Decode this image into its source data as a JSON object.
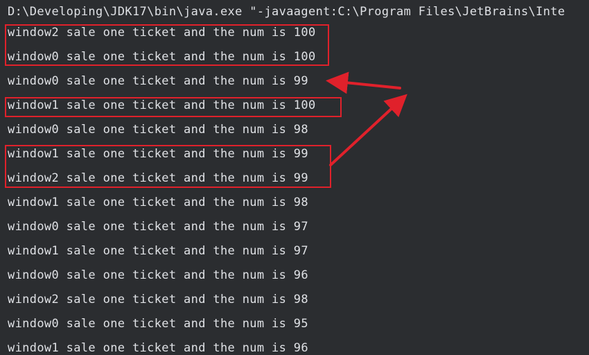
{
  "console": {
    "command": "D:\\Developing\\JDK17\\bin\\java.exe \"-javaagent:C:\\Program Files\\JetBrains\\Inte",
    "lines": [
      "window2 sale one ticket and the num is 100",
      "window0 sale one ticket and the num is 100",
      "window0 sale one ticket and the num is 99",
      "window1 sale one ticket and the num is 100",
      "window0 sale one ticket and the num is 98",
      "window1 sale one ticket and the num is 99",
      "window2 sale one ticket and the num is 99",
      "window1 sale one ticket and the num is 98",
      "window0 sale one ticket and the num is 97",
      "window1 sale one ticket and the num is 97",
      "window0 sale one ticket and the num is 96",
      "window2 sale one ticket and the num is 98",
      "window0 sale one ticket and the num is 95",
      "window1 sale one ticket and the num is 96"
    ]
  },
  "colors": {
    "background": "#2b2d30",
    "text": "#dfe1e5",
    "annotation": "#e0212b"
  }
}
